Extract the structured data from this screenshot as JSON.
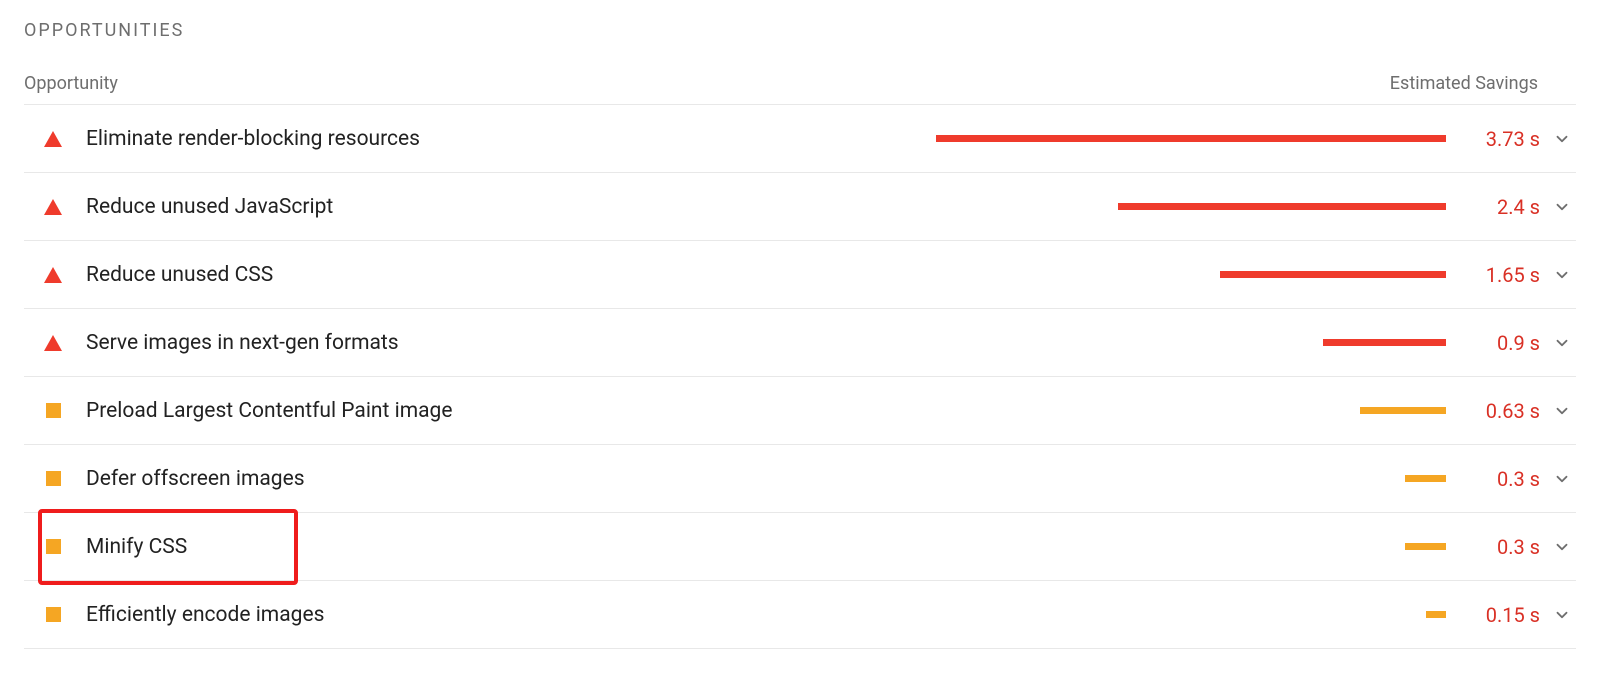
{
  "section_title": "OPPORTUNITIES",
  "header": {
    "left": "Opportunity",
    "right": "Estimated Savings"
  },
  "max_seconds": 3.73,
  "colors": {
    "red": "#ef3b2c",
    "orange": "#f5a623",
    "savings_text": "#d93025"
  },
  "opportunities": [
    {
      "severity": "red",
      "label": "Eliminate render-blocking resources",
      "seconds": 3.73,
      "savings_display": "3.73 s",
      "highlighted": false
    },
    {
      "severity": "red",
      "label": "Reduce unused JavaScript",
      "seconds": 2.4,
      "savings_display": "2.4 s",
      "highlighted": false
    },
    {
      "severity": "red",
      "label": "Reduce unused CSS",
      "seconds": 1.65,
      "savings_display": "1.65 s",
      "highlighted": false
    },
    {
      "severity": "red",
      "label": "Serve images in next-gen formats",
      "seconds": 0.9,
      "savings_display": "0.9 s",
      "highlighted": false
    },
    {
      "severity": "orange",
      "label": "Preload Largest Contentful Paint image",
      "seconds": 0.63,
      "savings_display": "0.63 s",
      "highlighted": false
    },
    {
      "severity": "orange",
      "label": "Defer offscreen images",
      "seconds": 0.3,
      "savings_display": "0.3 s",
      "highlighted": false
    },
    {
      "severity": "orange",
      "label": "Minify CSS",
      "seconds": 0.3,
      "savings_display": "0.3 s",
      "highlighted": true
    },
    {
      "severity": "orange",
      "label": "Efficiently encode images",
      "seconds": 0.15,
      "savings_display": "0.15 s",
      "highlighted": false
    }
  ]
}
